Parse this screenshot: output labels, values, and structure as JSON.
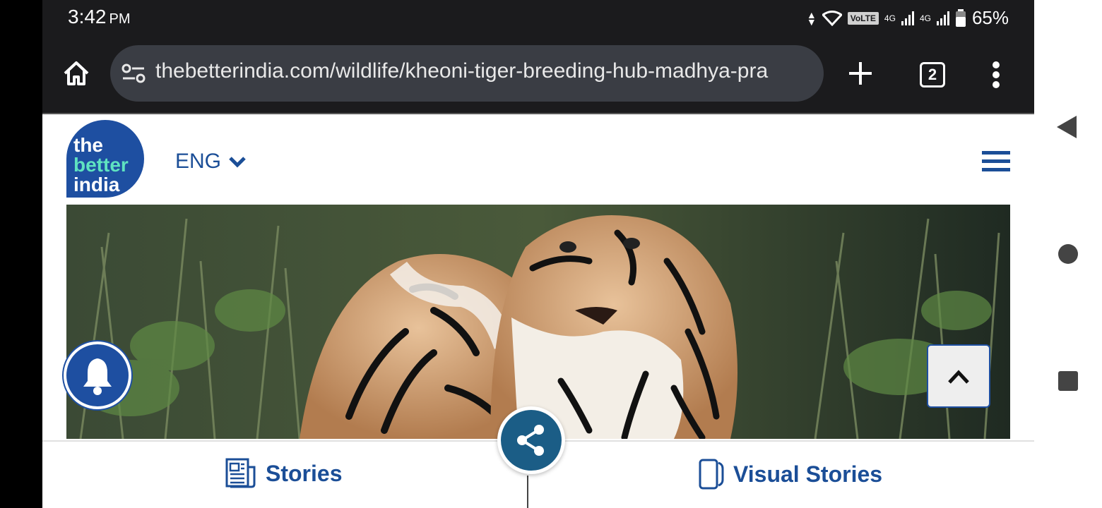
{
  "status_bar": {
    "time": "3:42",
    "ampm": "PM",
    "volte": "VoLTE",
    "net1": "4G",
    "net2": "4G",
    "battery": "65%"
  },
  "browser": {
    "url": "thebetterindia.com/wildlife/kheoni-tiger-breeding-hub-madhya-pra",
    "tab_count": "2"
  },
  "site": {
    "logo": {
      "line1": "the",
      "line2": "better",
      "line3": "india"
    },
    "language": "ENG"
  },
  "bottom_nav": {
    "stories": "Stories",
    "visual_stories": "Visual Stories"
  },
  "colors": {
    "brand_blue": "#1e4fa1",
    "brand_green": "#5fe3c0",
    "share_blue": "#1b5d86",
    "browser_dark": "#1b1b1d"
  }
}
